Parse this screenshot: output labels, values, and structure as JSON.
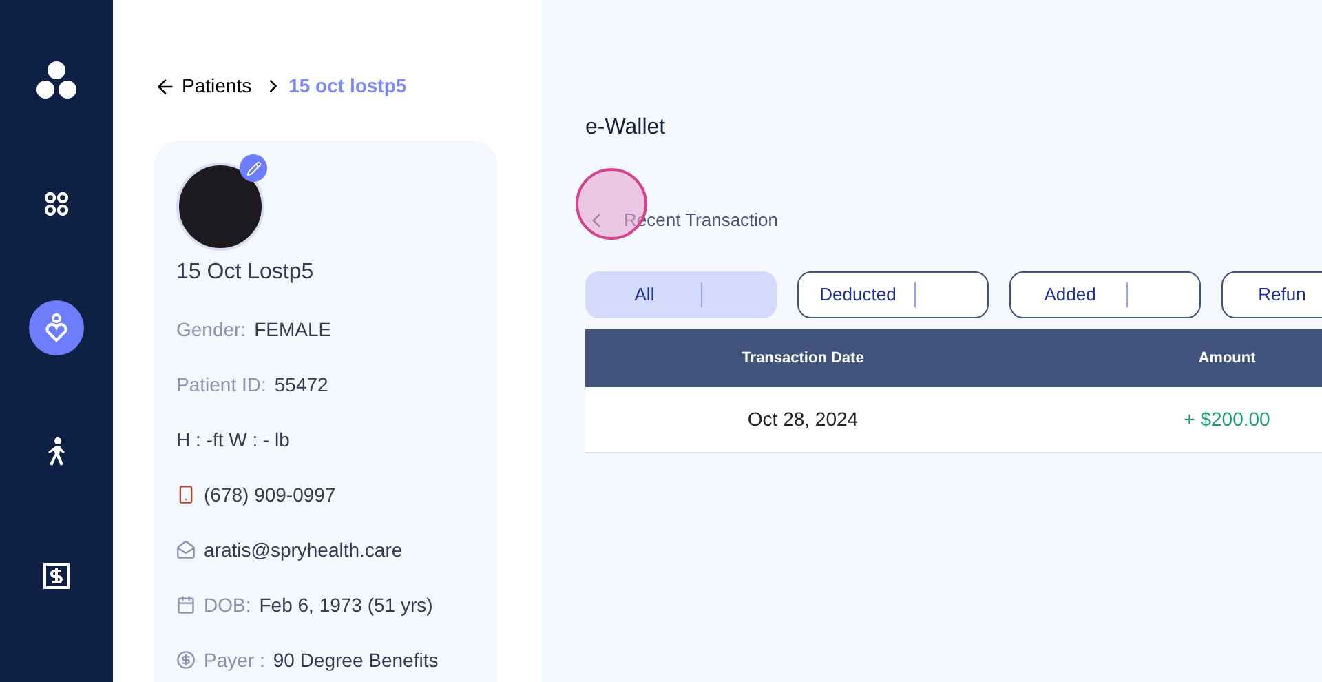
{
  "sidebar": {
    "items": [
      {
        "kind": "grid",
        "selected": false
      },
      {
        "kind": "patient",
        "selected": true
      },
      {
        "kind": "walk",
        "selected": false
      },
      {
        "kind": "billing",
        "selected": false
      }
    ]
  },
  "breadcrumb": {
    "parent": "Patients",
    "current": "15 oct lostp5"
  },
  "patient": {
    "name": "15 Oct Lostp5",
    "fields": [
      {
        "kind": "plain",
        "label": "Gender:",
        "value": "FEMALE"
      },
      {
        "kind": "plain",
        "label": "Patient ID:",
        "value": "55472"
      },
      {
        "kind": "text",
        "value": "H : -ft W : - lb"
      },
      {
        "kind": "phone",
        "value": "(678) 909-0997"
      },
      {
        "kind": "email",
        "value": "aratis@spryhealth.care"
      },
      {
        "kind": "dob",
        "label": "DOB:",
        "value": "Feb 6, 1973 (51 yrs)"
      },
      {
        "kind": "payer",
        "label": "Payer :",
        "value": "90 Degree Benefits"
      }
    ]
  },
  "wallet": {
    "title": "e-Wallet",
    "section": "Recent Transaction",
    "filters": [
      {
        "label": "All",
        "selected": true
      },
      {
        "label": "Deducted",
        "selected": false
      },
      {
        "label": "Added",
        "selected": false
      },
      {
        "label": "Refun",
        "selected": false
      }
    ],
    "table": {
      "columns": [
        "Transaction Date",
        "Amount"
      ],
      "rows": [
        {
          "date": "Oct 28, 2024",
          "amount": "+ $200.00"
        }
      ]
    }
  }
}
